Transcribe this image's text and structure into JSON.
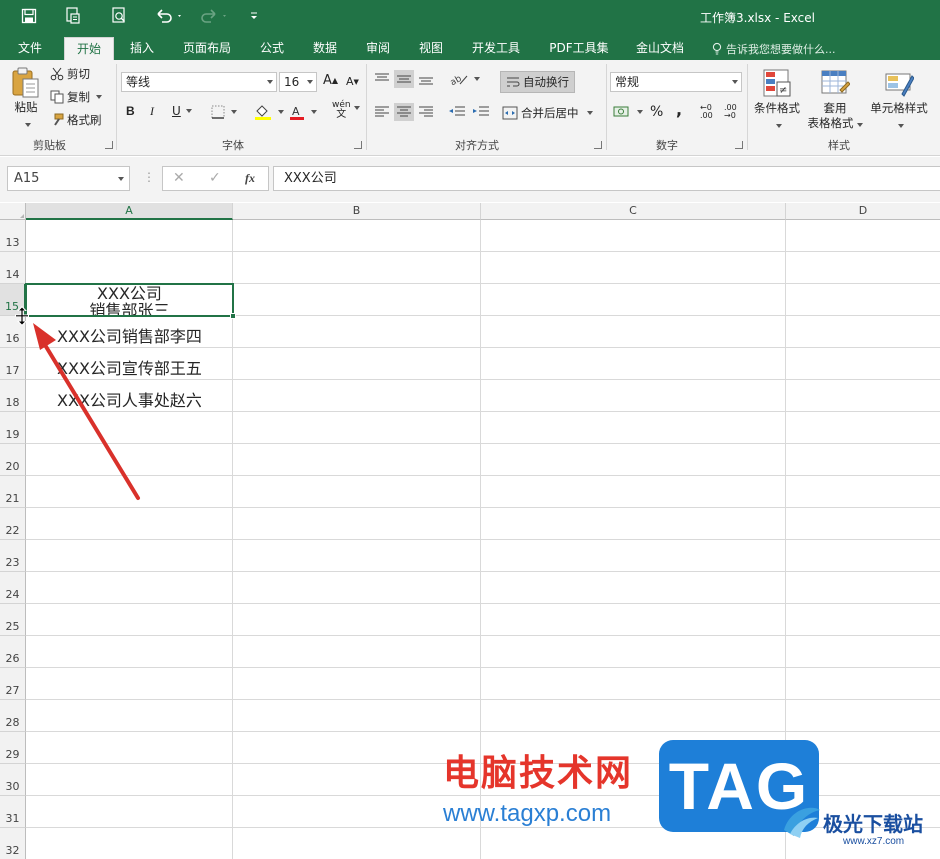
{
  "titlebar": {
    "title": "工作簿3.xlsx  -  Excel",
    "save_icon": "save-icon",
    "print_preview_icon": "print-preview-icon",
    "print_icon": "print-icon",
    "undo_icon": "undo-icon",
    "redo_icon": "redo-icon",
    "customize_icon": "customize-toolbar-icon"
  },
  "tabs": [
    "文件",
    "开始",
    "插入",
    "页面布局",
    "公式",
    "数据",
    "审阅",
    "视图",
    "开发工具",
    "PDF工具集",
    "金山文档"
  ],
  "active_tab": "开始",
  "tell_me": "告诉我您想要做什么...",
  "ribbon": {
    "clipboard": {
      "paste": "粘贴",
      "cut": "剪切",
      "copy": "复制",
      "format_painter": "格式刷",
      "label": "剪贴板"
    },
    "font": {
      "font_name": "等线",
      "font_size": "16",
      "bold": "B",
      "italic": "I",
      "underline": "U",
      "grow": "A",
      "shrink": "A",
      "font_color_letter": "A",
      "phonetic": "wén",
      "phonetic_sub": "文",
      "label": "字体"
    },
    "alignment": {
      "wrap_text": "自动换行",
      "merge_center": "合并后居中",
      "label": "对齐方式"
    },
    "number": {
      "format": "常规",
      "percent": "%",
      "comma": ",",
      "inc_decimal": "←0 .00",
      "dec_decimal": ".00 →0",
      "label": "数字"
    },
    "styles": {
      "conditional": "条件格式",
      "table_format_1": "套用",
      "table_format_2": "表格格式",
      "cell_styles": "单元格样式",
      "label": "样式"
    }
  },
  "formula_bar": {
    "name_box": "A15",
    "cancel": "✕",
    "enter": "✓",
    "fx": "fx",
    "content": "XXX公司"
  },
  "grid": {
    "columns": [
      "A",
      "B",
      "C",
      "D"
    ],
    "selected_column": "A",
    "rows": [
      "13",
      "14",
      "15",
      "16",
      "17",
      "18",
      "19",
      "20",
      "21",
      "22",
      "23",
      "24",
      "25",
      "26",
      "27",
      "28",
      "29",
      "30",
      "31",
      "32"
    ],
    "selected_row": "15",
    "cells": {
      "A15_line1": "XXX公司",
      "A15_line2": "销售部张三",
      "A16": "XXX公司销售部李四",
      "A17": "XXX公司宣传部王五",
      "A18": "XXX公司人事处赵六"
    }
  },
  "watermark": {
    "cn": "电脑技术网",
    "url": "www.tagxp.com",
    "tag": "TAG",
    "site": "极光下载站",
    "site_url": "www.xz7.com"
  },
  "colors": {
    "excel_green": "#217346",
    "arrow_red": "#d9312b"
  }
}
